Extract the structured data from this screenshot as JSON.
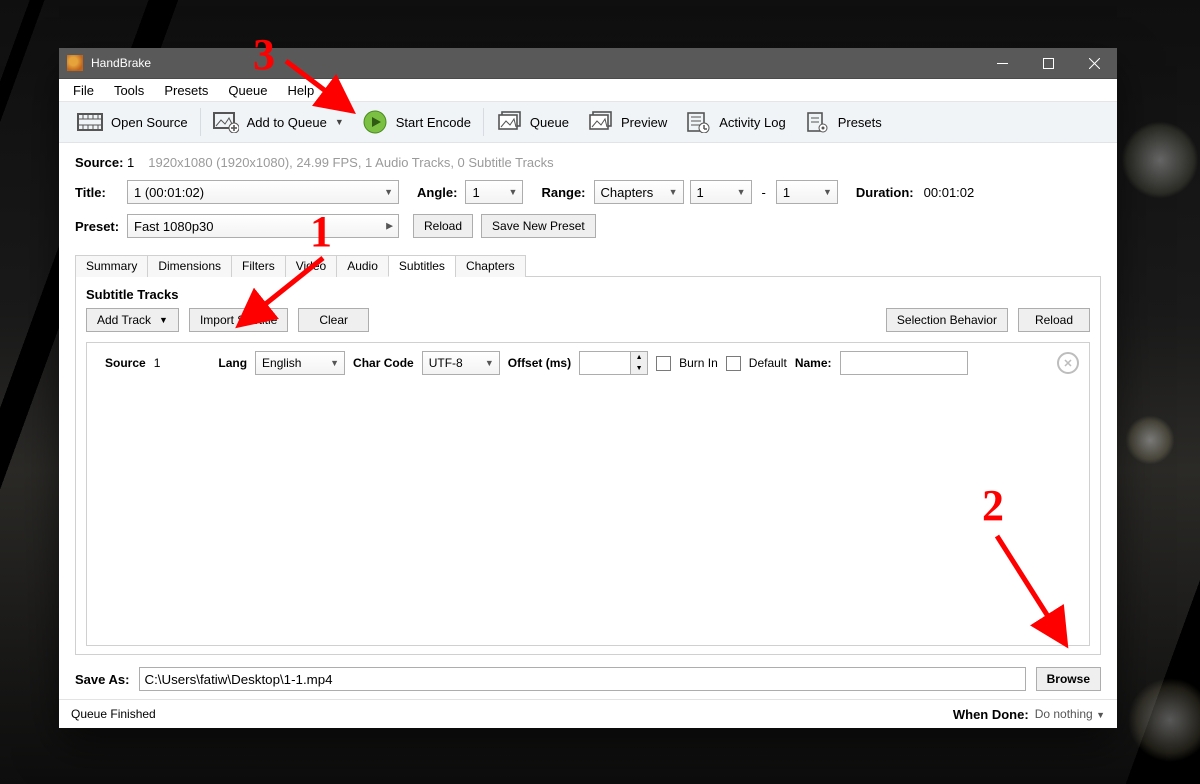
{
  "app": {
    "title": "HandBrake"
  },
  "menu": {
    "items": [
      "File",
      "Tools",
      "Presets",
      "Queue",
      "Help"
    ]
  },
  "toolbar": {
    "open_source": "Open Source",
    "add_to_queue": "Add to Queue",
    "start_encode": "Start Encode",
    "queue": "Queue",
    "preview": "Preview",
    "activity_log": "Activity Log",
    "presets": "Presets"
  },
  "source": {
    "label": "Source:",
    "index": "1",
    "info": "1920x1080 (1920x1080), 24.99 FPS, 1 Audio Tracks, 0 Subtitle Tracks"
  },
  "title": {
    "label": "Title:",
    "value": "1 (00:01:02)",
    "angle_label": "Angle:",
    "angle": "1",
    "range_label": "Range:",
    "range_type": "Chapters",
    "range_from": "1",
    "range_sep": "-",
    "range_to": "1",
    "duration_label": "Duration:",
    "duration": "00:01:02"
  },
  "preset": {
    "label": "Preset:",
    "value": "Fast 1080p30",
    "reload": "Reload",
    "save_new": "Save New Preset"
  },
  "tabs": [
    "Summary",
    "Dimensions",
    "Filters",
    "Video",
    "Audio",
    "Subtitles",
    "Chapters"
  ],
  "tabs_active": 5,
  "subtitles": {
    "heading": "Subtitle Tracks",
    "add_track": "Add Track",
    "import": "Import Subtitle",
    "clear": "Clear",
    "selection_behavior": "Selection Behavior",
    "reload": "Reload",
    "track": {
      "source_label": "Source",
      "source_index": "1",
      "lang_label": "Lang",
      "lang": "English",
      "charcode_label": "Char Code",
      "charcode": "UTF-8",
      "offset_label": "Offset (ms)",
      "offset": "",
      "burnin_label": "Burn In",
      "default_label": "Default",
      "name_label": "Name:",
      "name": ""
    }
  },
  "saveas": {
    "label": "Save As:",
    "path": "C:\\Users\\fatiw\\Desktop\\1-1.mp4",
    "browse": "Browse"
  },
  "status": {
    "queue": "Queue Finished",
    "when_done_label": "When Done:",
    "when_done": "Do nothing"
  },
  "annotations": {
    "n1": "1",
    "n2": "2",
    "n3": "3"
  }
}
